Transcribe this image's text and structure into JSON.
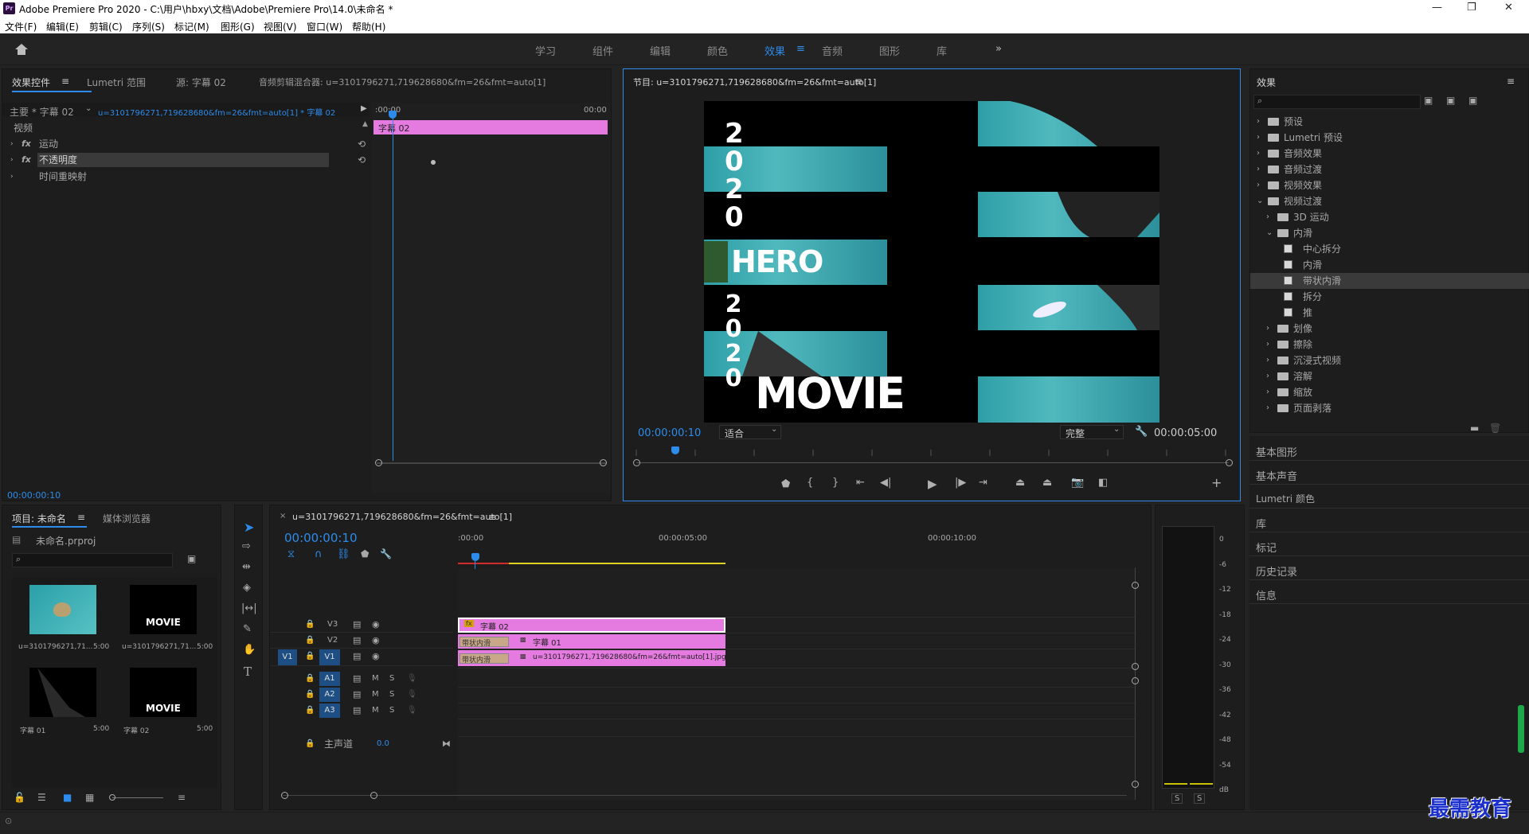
{
  "app": {
    "logo": "Pr",
    "title": "Adobe Premiere Pro 2020 - C:\\用户\\hbxy\\文档\\Adobe\\Premiere Pro\\14.0\\未命名 *",
    "min": "—",
    "max": "❐",
    "close": "✕"
  },
  "menu": [
    "文件(F)",
    "编辑(E)",
    "剪辑(C)",
    "序列(S)",
    "标记(M)",
    "图形(G)",
    "视图(V)",
    "窗口(W)",
    "帮助(H)"
  ],
  "workspaces": [
    "学习",
    "组件",
    "编辑",
    "颜色",
    "效果",
    "音频",
    "图形",
    "库"
  ],
  "workspaces_more": "»",
  "effect_controls": {
    "tabs": [
      "效果控件",
      "Lumetri 范围",
      "源: 字幕 02",
      "音频剪辑混合器: u=3101796271,719628680&fm=26&fmt=auto[1]"
    ],
    "master": "主要 * 字幕 02",
    "clip": "u=3101796271,719628680&fm=26&fmt=auto[1] * 字幕 02",
    "t_start": ":00:00",
    "t_end": "00:00",
    "clip_label": "字幕 02",
    "section": "视频",
    "props": [
      "运动",
      "不透明度",
      "时间重映射"
    ],
    "timecode": "00:00:00:10"
  },
  "program": {
    "title": "节目: u=3101796271,719628680&fm=26&fmt=auto[1]",
    "left_text": [
      "2",
      "0",
      "2",
      "0",
      "HERO",
      "2",
      "0",
      "2",
      "0",
      "MOVIE"
    ],
    "timecode": "00:00:00:10",
    "fit": "适合",
    "quality": "完整",
    "duration": "00:00:05:00"
  },
  "effects": {
    "title": "效果",
    "search_placeholder": "",
    "tree": [
      {
        "label": "预设",
        "level": 0,
        "type": "folder",
        "open": false
      },
      {
        "label": "Lumetri 预设",
        "level": 0,
        "type": "folder",
        "open": false
      },
      {
        "label": "音频效果",
        "level": 0,
        "type": "folder",
        "open": false
      },
      {
        "label": "音频过渡",
        "level": 0,
        "type": "folder",
        "open": false
      },
      {
        "label": "视频效果",
        "level": 0,
        "type": "folder",
        "open": false
      },
      {
        "label": "视频过渡",
        "level": 0,
        "type": "folder",
        "open": true
      },
      {
        "label": "3D 运动",
        "level": 1,
        "type": "folder",
        "open": false
      },
      {
        "label": "内滑",
        "level": 1,
        "type": "folder",
        "open": true
      },
      {
        "label": "中心拆分",
        "level": 2,
        "type": "fx"
      },
      {
        "label": "内滑",
        "level": 2,
        "type": "fx"
      },
      {
        "label": "带状内滑",
        "level": 2,
        "type": "fx",
        "selected": true
      },
      {
        "label": "拆分",
        "level": 2,
        "type": "fx"
      },
      {
        "label": "推",
        "level": 2,
        "type": "fx"
      },
      {
        "label": "划像",
        "level": 1,
        "type": "folder",
        "open": false
      },
      {
        "label": "擦除",
        "level": 1,
        "type": "folder",
        "open": false
      },
      {
        "label": "沉浸式视频",
        "level": 1,
        "type": "folder",
        "open": false
      },
      {
        "label": "溶解",
        "level": 1,
        "type": "folder",
        "open": false
      },
      {
        "label": "缩放",
        "level": 1,
        "type": "folder",
        "open": false
      },
      {
        "label": "页面剥落",
        "level": 1,
        "type": "folder",
        "open": false
      }
    ],
    "panels": [
      "基本图形",
      "基本声音",
      "Lumetri 颜色",
      "库",
      "标记",
      "历史记录",
      "信息"
    ]
  },
  "project": {
    "tabs": [
      "项目: 未命名",
      "媒体浏览器"
    ],
    "file": "未命名.prproj",
    "items": [
      {
        "name": "u=3101796271,71...",
        "dur": "5:00"
      },
      {
        "name": "u=3101796271,71...",
        "dur": "5:00"
      },
      {
        "name": "字幕 01",
        "dur": "5:00"
      },
      {
        "name": "字幕 02",
        "dur": "5:00"
      }
    ],
    "thumb_text": "MOVIE"
  },
  "timeline": {
    "tab": "u=3101796271,719628680&fm=26&fmt=auto[1]",
    "timecode": "00:00:00:10",
    "ruler": [
      ":00:00",
      "00:00:05:00",
      "00:00:10:00"
    ],
    "tracks_v": [
      "V3",
      "V2",
      "V1"
    ],
    "tracks_a": [
      "A1",
      "A2",
      "A3"
    ],
    "src_v": "V1",
    "master": "主声道",
    "master_val": "0.0",
    "clip_v3": "字幕 02",
    "clip_v2": "字幕 01",
    "clip_v1": "u=3101796271,719628680&fm=26&fmt=auto[1].jpg",
    "transition": "带状内滑",
    "m": "M",
    "s": "S"
  },
  "meter": {
    "scale": [
      "0",
      "-6",
      "-12",
      "-18",
      "-24",
      "-30",
      "-36",
      "-42",
      "-48",
      "-54",
      "dB"
    ],
    "solo": "S"
  },
  "watermark": "最需教育"
}
